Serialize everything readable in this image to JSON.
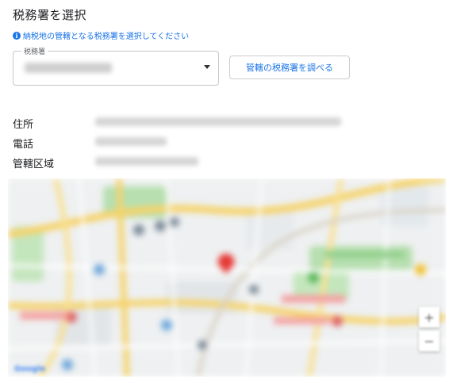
{
  "page": {
    "title": "税務署を選択",
    "hint": "納税地の管轄となる税務署を選択してください"
  },
  "select": {
    "legend": "税務署",
    "value": ""
  },
  "lookup_button": {
    "label": "管轄の税務署を調べる"
  },
  "details": {
    "address_label": "住所",
    "phone_label": "電話",
    "area_label": "管轄区域"
  },
  "map": {
    "zoom_in_symbol": "+",
    "zoom_out_symbol": "−",
    "attribution": "Google",
    "colors": {
      "road_major": "#f6d36a",
      "road_minor": "#ffffff",
      "park": "#b7dfb0",
      "base": "#eef0f1",
      "marker": "#e53935"
    }
  },
  "icons": {
    "hint_icon": "info-icon",
    "select_icon": "caret-down-icon",
    "map_marker": "map-pin-icon"
  }
}
